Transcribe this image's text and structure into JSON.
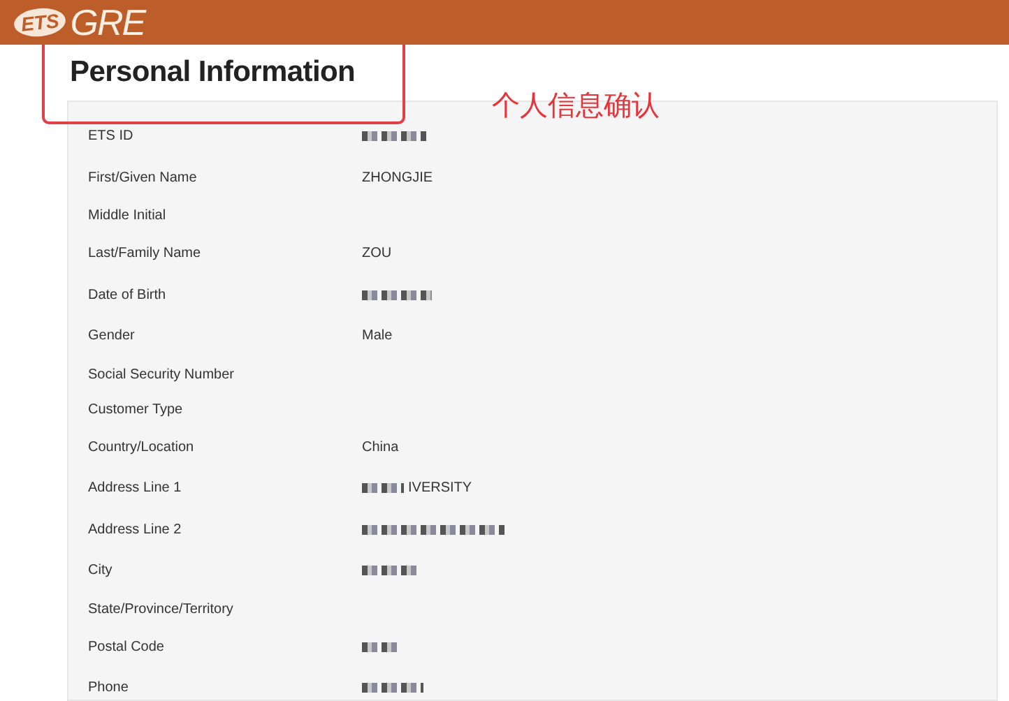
{
  "header": {
    "logo_badge": "ETS",
    "logo_text": "GRE"
  },
  "page": {
    "title": "Personal Information",
    "annotation": "个人信息确认"
  },
  "fields": [
    {
      "label": "ETS ID",
      "redacted": true
    },
    {
      "label": "First/Given Name",
      "value": "ZHONGJIE",
      "redacted": false
    },
    {
      "label": "Middle Initial",
      "redacted": false
    },
    {
      "label": "Last/Family Name",
      "value": "ZOU",
      "redacted": false
    },
    {
      "label": "Date of Birth",
      "redacted": true
    },
    {
      "label": "Gender",
      "value": "Male",
      "redacted": false
    },
    {
      "label": "Social Security Number",
      "redacted": false
    },
    {
      "label": "Customer Type",
      "redacted": false
    },
    {
      "label": "Country/Location",
      "value": "China",
      "redacted": false
    },
    {
      "label": "Address Line 1",
      "value": "IVERSITY",
      "redacted": true
    },
    {
      "label": "Address Line 2",
      "redacted": true
    },
    {
      "label": "City",
      "redacted": true
    },
    {
      "label": "State/Province/Territory",
      "redacted": false
    },
    {
      "label": "Postal Code",
      "redacted": true
    },
    {
      "label": "Phone",
      "redacted": true
    }
  ]
}
